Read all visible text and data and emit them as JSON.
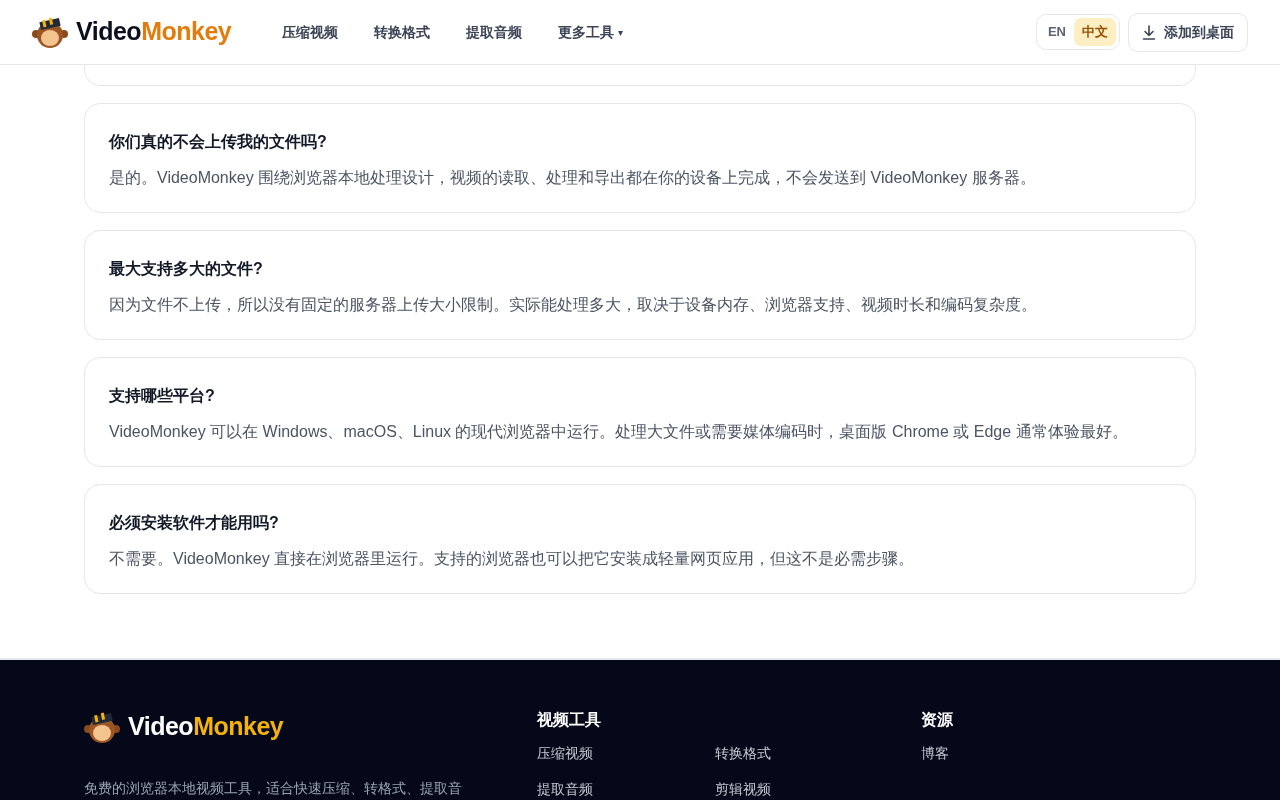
{
  "header": {
    "logo": {
      "part_1": "Video",
      "part_2": "Monkey"
    },
    "nav": [
      {
        "label": "压缩视频"
      },
      {
        "label": "转换格式"
      },
      {
        "label": "提取音频"
      },
      {
        "label": "更多工具",
        "caret": "▾"
      }
    ],
    "languages": [
      {
        "label": "EN",
        "selected": false
      },
      {
        "label": "中文",
        "selected": true
      }
    ],
    "install_button": "添加到桌面"
  },
  "faq": [
    {
      "question": "你们真的不会上传我的文件吗?",
      "answer": "是的。VideoMonkey 围绕浏览器本地处理设计，视频的读取、处理和导出都在你的设备上完成，不会发送到 VideoMonkey 服务器。"
    },
    {
      "question": "最大支持多大的文件?",
      "answer": "因为文件不上传，所以没有固定的服务器上传大小限制。实际能处理多大，取决于设备内存、浏览器支持、视频时长和编码复杂度。"
    },
    {
      "question": "支持哪些平台?",
      "answer": "VideoMonkey 可以在 Windows、macOS、Linux 的现代浏览器中运行。处理大文件或需要媒体编码时，桌面版 Chrome 或 Edge 通常体验最好。"
    },
    {
      "question": "必须安装软件才能用吗?",
      "answer": "不需要。VideoMonkey 直接在浏览器里运行。支持的浏览器也可以把它安装成轻量网页应用，但这不是必需步骤。"
    }
  ],
  "footer": {
    "logo": {
      "part_1": "Video",
      "part_2": "Monkey"
    },
    "description": "免费的浏览器本地视频工具，适合快速压缩、转格式、提取音",
    "columns": [
      {
        "title": "视频工具",
        "links": [
          "压缩视频",
          "转换格式",
          "提取音频",
          "剪辑视频"
        ]
      },
      {
        "title": "资源",
        "links": [
          "博客"
        ]
      }
    ]
  }
}
